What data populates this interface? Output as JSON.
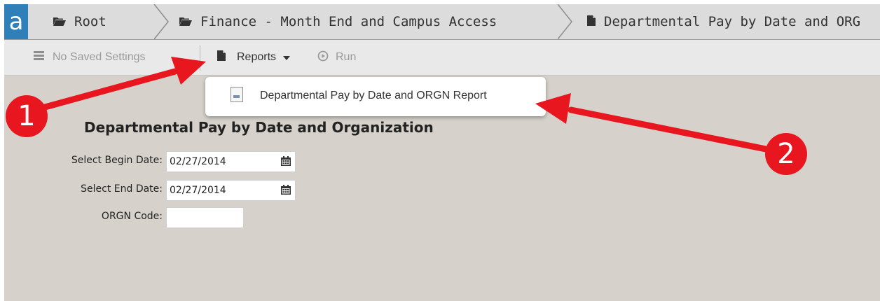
{
  "logo": "a",
  "breadcrumb": {
    "items": [
      "Root",
      "Finance - Month End and Campus Access",
      "Departmental Pay by Date and ORG"
    ]
  },
  "toolbar": {
    "saved_settings": "No Saved Settings",
    "reports": "Reports",
    "run": "Run"
  },
  "dropdown": {
    "items": [
      "Departmental Pay by Date and ORGN Report"
    ]
  },
  "form": {
    "title": "Departmental Pay by Date and Organization",
    "fields": [
      {
        "label": "Select Begin Date:",
        "value": "02/27/2014"
      },
      {
        "label": "Select End Date:",
        "value": "02/27/2014"
      },
      {
        "label": "ORGN Code:",
        "value": ""
      }
    ]
  },
  "annotations": {
    "badge1": "1",
    "badge2": "2",
    "color": "#e8161e"
  }
}
